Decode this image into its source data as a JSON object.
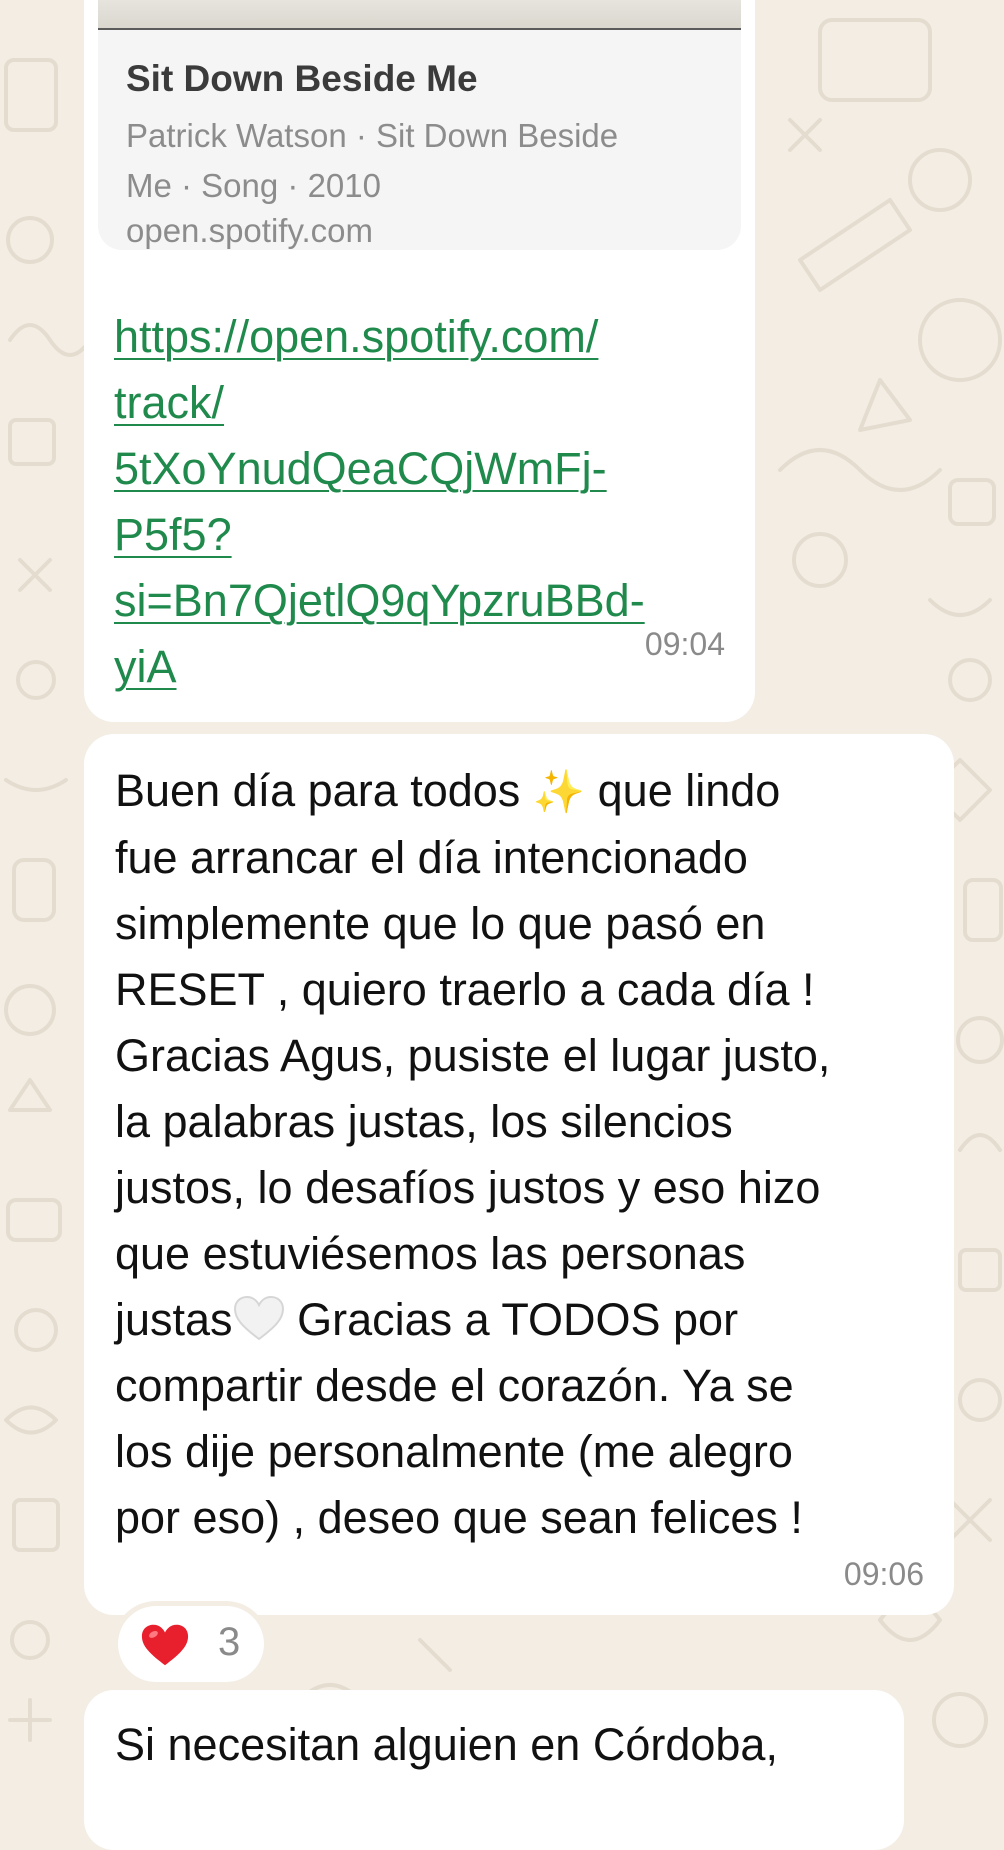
{
  "messages": [
    {
      "preview": {
        "title": "Sit Down Beside Me",
        "desc_line1": "Patrick Watson · Sit Down Beside",
        "desc_line2": "Me · Song · 2010",
        "domain": "open.spotify.com"
      },
      "link_lines": [
        "https://open.spotify.com/",
        "track/",
        "5tXoYnudQeaCQjWmFj-",
        "P5f5?",
        "si=Bn7QjetlQ9qYpzruBBd-",
        "yiA"
      ],
      "time": "09:04"
    },
    {
      "lines": [
        "Buen día para todos",
        "que lindo",
        "fue arrancar el día intencionado",
        "simplemente que lo que pasó en",
        "RESET , quiero traerlo a  cada día !",
        "Gracias Agus, pusiste el lugar justo,",
        "la palabras justas, los silencios",
        "justos, lo desafíos justos y eso hizo",
        "que estuviésemos las personas",
        "justas",
        "Gracias a TODOS  por",
        "compartir desde el corazón. Ya se",
        "los dije personalmente (me alegro",
        "por eso) , deseo  que sean felices !"
      ],
      "emoji_sparkles": "✨",
      "time": "09:06",
      "reaction": {
        "emoji": "heart-red-icon",
        "count": "3"
      }
    },
    {
      "lines": [
        "Si necesitan alguien en Córdoba,"
      ]
    }
  ],
  "colors": {
    "background": "#f3ede4",
    "bubble": "#ffffff",
    "link": "#208a4d",
    "timestamp": "#8a8a8a"
  }
}
